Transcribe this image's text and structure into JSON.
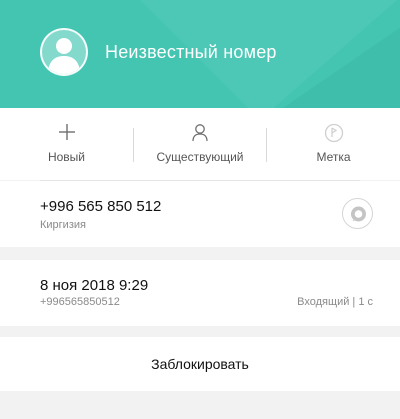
{
  "header": {
    "title": "Неизвестный номер",
    "avatar_icon": "person-avatar-icon",
    "bg_color": "#43c5b2"
  },
  "actions": [
    {
      "label": "Новый",
      "icon": "plus-icon"
    },
    {
      "label": "Существующий",
      "icon": "person-icon"
    },
    {
      "label": "Метка",
      "icon": "tag-icon"
    }
  ],
  "number": {
    "phone": "+996 565 850 512",
    "country": "Киргизия",
    "message_icon": "message-icon"
  },
  "call_log": {
    "date": "8 ноя 2018 9:29",
    "number": "+996565850512",
    "info": "Входящий | 1 с"
  },
  "block": {
    "label": "Заблокировать"
  }
}
